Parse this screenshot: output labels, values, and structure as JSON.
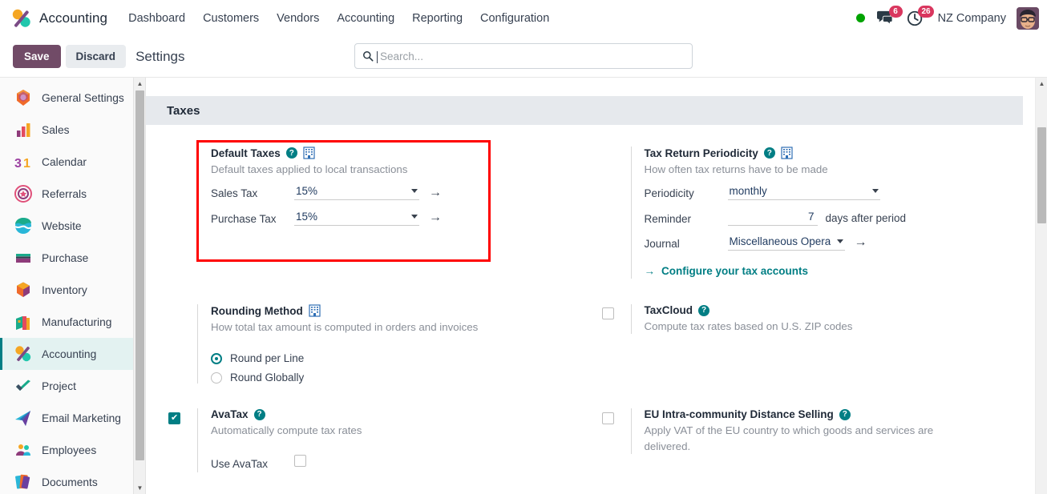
{
  "app": {
    "name": "Accounting",
    "logo_icon": "accounting-logo-icon"
  },
  "navbar": {
    "menu_items": [
      {
        "label": "Dashboard"
      },
      {
        "label": "Customers"
      },
      {
        "label": "Vendors"
      },
      {
        "label": "Accounting"
      },
      {
        "label": "Reporting"
      },
      {
        "label": "Configuration"
      }
    ],
    "status_indicator": "online-dot-icon",
    "messages": {
      "icon": "chat-icon",
      "count": "6"
    },
    "activities": {
      "icon": "clock-icon",
      "count": "26"
    },
    "company": "NZ Company",
    "avatar": "user-avatar"
  },
  "controls": {
    "save_label": "Save",
    "discard_label": "Discard",
    "page_title": "Settings"
  },
  "search": {
    "placeholder": "Search...",
    "value": "",
    "icon": "search-icon"
  },
  "sidebar": {
    "items": [
      {
        "label": "General Settings",
        "icon": "general-settings-icon",
        "active": false
      },
      {
        "label": "Sales",
        "icon": "sales-icon",
        "active": false
      },
      {
        "label": "Calendar",
        "icon": "calendar-icon",
        "active": false
      },
      {
        "label": "Referrals",
        "icon": "referrals-icon",
        "active": false
      },
      {
        "label": "Website",
        "icon": "website-icon",
        "active": false
      },
      {
        "label": "Purchase",
        "icon": "purchase-icon",
        "active": false
      },
      {
        "label": "Inventory",
        "icon": "inventory-icon",
        "active": false
      },
      {
        "label": "Manufacturing",
        "icon": "manufacturing-icon",
        "active": false
      },
      {
        "label": "Accounting",
        "icon": "accounting-icon",
        "active": true
      },
      {
        "label": "Project",
        "icon": "project-icon",
        "active": false
      },
      {
        "label": "Email Marketing",
        "icon": "email-marketing-icon",
        "active": false
      },
      {
        "label": "Employees",
        "icon": "employees-icon",
        "active": false
      },
      {
        "label": "Documents",
        "icon": "documents-icon",
        "active": false
      }
    ]
  },
  "section": {
    "title": "Taxes"
  },
  "settings": {
    "default_taxes": {
      "title": "Default Taxes",
      "description": "Default taxes applied to local transactions",
      "help_icon": "help-icon",
      "company_icon": "company-building-icon",
      "sales_tax": {
        "label": "Sales Tax",
        "value": "15%"
      },
      "purchase_tax": {
        "label": "Purchase Tax",
        "value": "15%"
      }
    },
    "tax_return_periodicity": {
      "title": "Tax Return Periodicity",
      "description": "How often tax returns have to be made",
      "help_icon": "help-icon",
      "company_icon": "company-building-icon",
      "periodicity": {
        "label": "Periodicity",
        "value": "monthly"
      },
      "reminder": {
        "label": "Reminder",
        "value": "7",
        "suffix": "days after period"
      },
      "journal": {
        "label": "Journal",
        "value": "Miscellaneous Operat"
      },
      "configure_link": "Configure your tax accounts"
    },
    "rounding_method": {
      "title": "Rounding Method",
      "description": "How total tax amount is computed in orders and invoices",
      "company_icon": "company-building-icon",
      "options": [
        {
          "label": "Round per Line",
          "selected": true
        },
        {
          "label": "Round Globally",
          "selected": false
        }
      ]
    },
    "taxcloud": {
      "title": "TaxCloud",
      "description": "Compute tax rates based on U.S. ZIP codes",
      "help_icon": "help-icon",
      "checked": false
    },
    "avatax": {
      "title": "AvaTax",
      "description": "Automatically compute tax rates",
      "help_icon": "help-icon",
      "checked": true,
      "sub_field": {
        "label": "Use AvaTax",
        "checked": false
      }
    },
    "eu_distance_selling": {
      "title": "EU Intra-community Distance Selling",
      "description": "Apply VAT of the EU country to which goods and services are delivered.",
      "help_icon": "help-icon",
      "checked": false
    }
  },
  "colors": {
    "accent": "#017e84",
    "save_button": "#714B67",
    "badge": "#d9365e",
    "highlight_box": "#ff0000",
    "online": "#00a300"
  }
}
